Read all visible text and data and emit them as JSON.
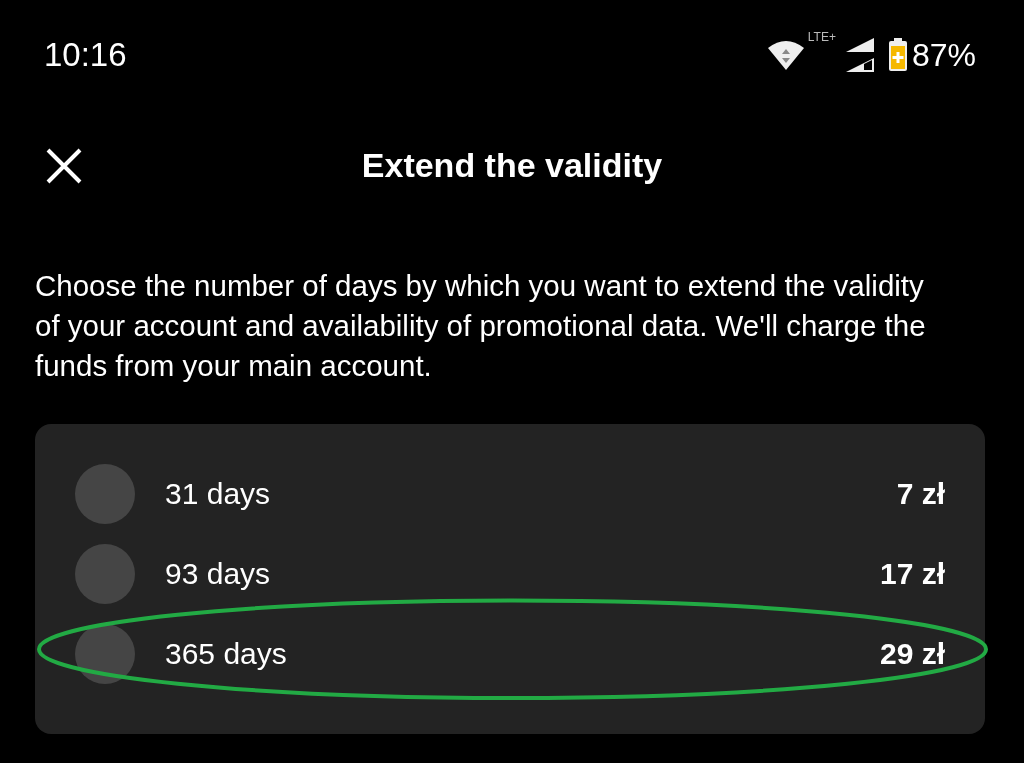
{
  "status_bar": {
    "time": "10:16",
    "network": "LTE+",
    "battery": "87%"
  },
  "header": {
    "title": "Extend the validity"
  },
  "description": "Choose the number of days by which you want to extend the validity of your account and availability of promotional data. We'll charge the funds from your main account.",
  "options": [
    {
      "label": "31 days",
      "price": "7 zł",
      "selected": false,
      "highlighted": false
    },
    {
      "label": "93 days",
      "price": "17 zł",
      "selected": false,
      "highlighted": false
    },
    {
      "label": "365 days",
      "price": "29 zł",
      "selected": false,
      "highlighted": true
    }
  ]
}
